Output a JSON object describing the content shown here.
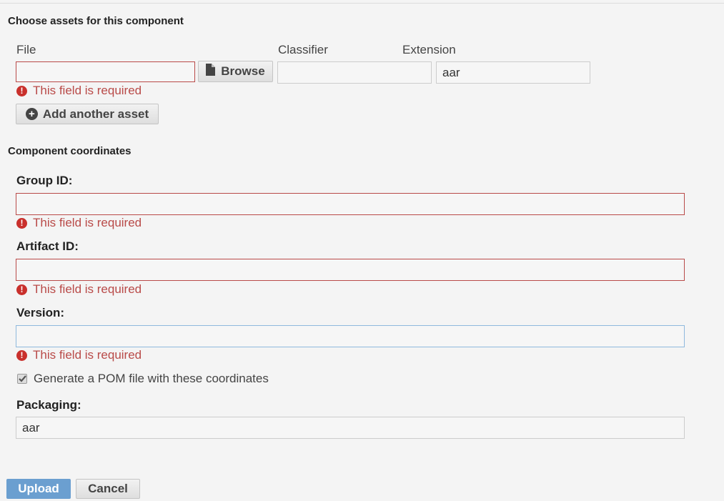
{
  "assets": {
    "section_title": "Choose assets for this component",
    "columns": {
      "file": "File",
      "classifier": "Classifier",
      "extension": "Extension"
    },
    "file_value": "",
    "browse_label": "Browse",
    "classifier_value": "",
    "extension_value": "aar",
    "file_error": "This field is required",
    "add_asset_label": "Add another asset"
  },
  "coordinates": {
    "section_title": "Component coordinates",
    "group_id": {
      "label": "Group ID:",
      "value": "",
      "error": "This field is required"
    },
    "artifact_id": {
      "label": "Artifact ID:",
      "value": "",
      "error": "This field is required"
    },
    "version": {
      "label": "Version:",
      "value": "",
      "error": "This field is required"
    },
    "generate_pom": {
      "label": "Generate a POM file with these coordinates",
      "checked": true
    },
    "packaging": {
      "label": "Packaging:",
      "value": "aar"
    }
  },
  "actions": {
    "upload_label": "Upload",
    "cancel_label": "Cancel"
  },
  "colors": {
    "error": "#b94a48",
    "primary": "#6b9fd0",
    "focus": "#8fb9dd",
    "background": "#f4f4f4"
  },
  "icons": {
    "error": "exclamation-circle-icon",
    "file": "file-icon",
    "add": "plus-circle-icon",
    "check": "checkmark-icon"
  }
}
